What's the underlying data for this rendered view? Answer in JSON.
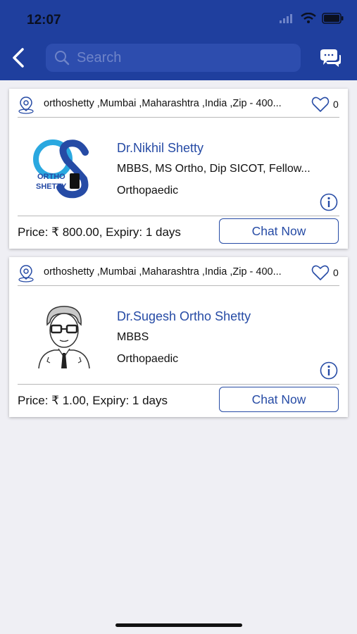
{
  "status_bar": {
    "time": "12:07"
  },
  "header": {
    "search_placeholder": "Search"
  },
  "doctors": [
    {
      "address": "orthoshetty ,Mumbai ,Maharashtra ,India ,Zip - 400...",
      "likes": "0",
      "name": "Dr.Nikhil Shetty",
      "degree": "MBBS, MS Ortho, Dip SICOT,  Fellow...",
      "specialty": "Orthopaedic",
      "price": "Price: ₹ 800.00, Expiry: 1 days",
      "chat_label": "Chat Now",
      "logo_text_1": "ORTHO",
      "logo_text_2": "SHETTY"
    },
    {
      "address": "orthoshetty ,Mumbai ,Maharashtra ,India ,Zip - 400...",
      "likes": "0",
      "name": "Dr.Sugesh Ortho Shetty",
      "degree": "MBBS",
      "specialty": "Orthopaedic",
      "price": "Price: ₹ 1.00, Expiry: 1 days",
      "chat_label": "Chat Now"
    }
  ],
  "colors": {
    "primary": "#1f3f9e",
    "accent": "#264ba5",
    "background": "#efeff4"
  }
}
